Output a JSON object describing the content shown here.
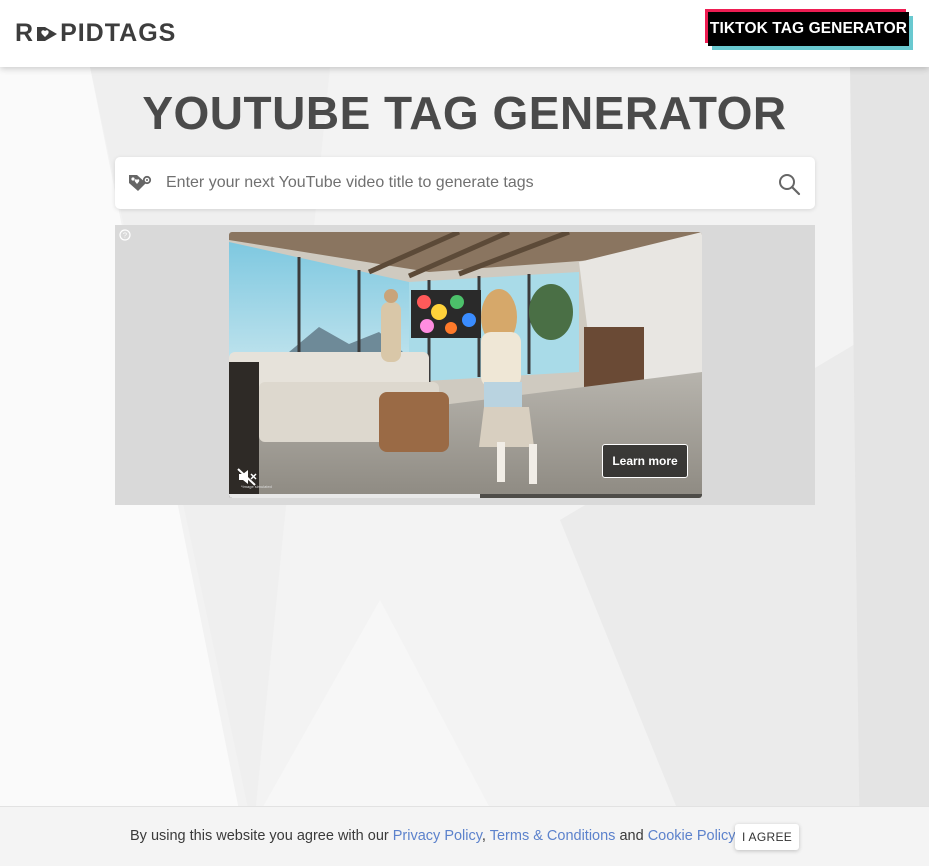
{
  "header": {
    "logo_text_start": "R",
    "logo_text_end": "PIDTAGS",
    "tiktok_button_label": "TIKTOK TAG GENERATOR"
  },
  "main": {
    "title": "YOUTUBE TAG GENERATOR",
    "search": {
      "placeholder": "Enter your next YouTube video title to generate tags",
      "value": ""
    }
  },
  "ad": {
    "learn_more_label": "Learn more",
    "mute_caption": "*Image simulated",
    "progress": 0.53
  },
  "cookie_bar": {
    "text_prefix": "By using this website you agree with our ",
    "privacy_link": "Privacy Policy",
    "separator": ", ",
    "terms_link": "Terms & Conditions",
    "and_text": " and ",
    "cookie_link": "Cookie Policy",
    "agree_label": "I AGREE"
  },
  "colors": {
    "tiktok_red": "#ee1d52",
    "tiktok_cyan": "#69c9d0",
    "link_blue": "#5c82cc",
    "title_gray": "#4a4a4a"
  },
  "icons": [
    "tag-icon",
    "search-icon",
    "help-icon",
    "mute-icon"
  ]
}
